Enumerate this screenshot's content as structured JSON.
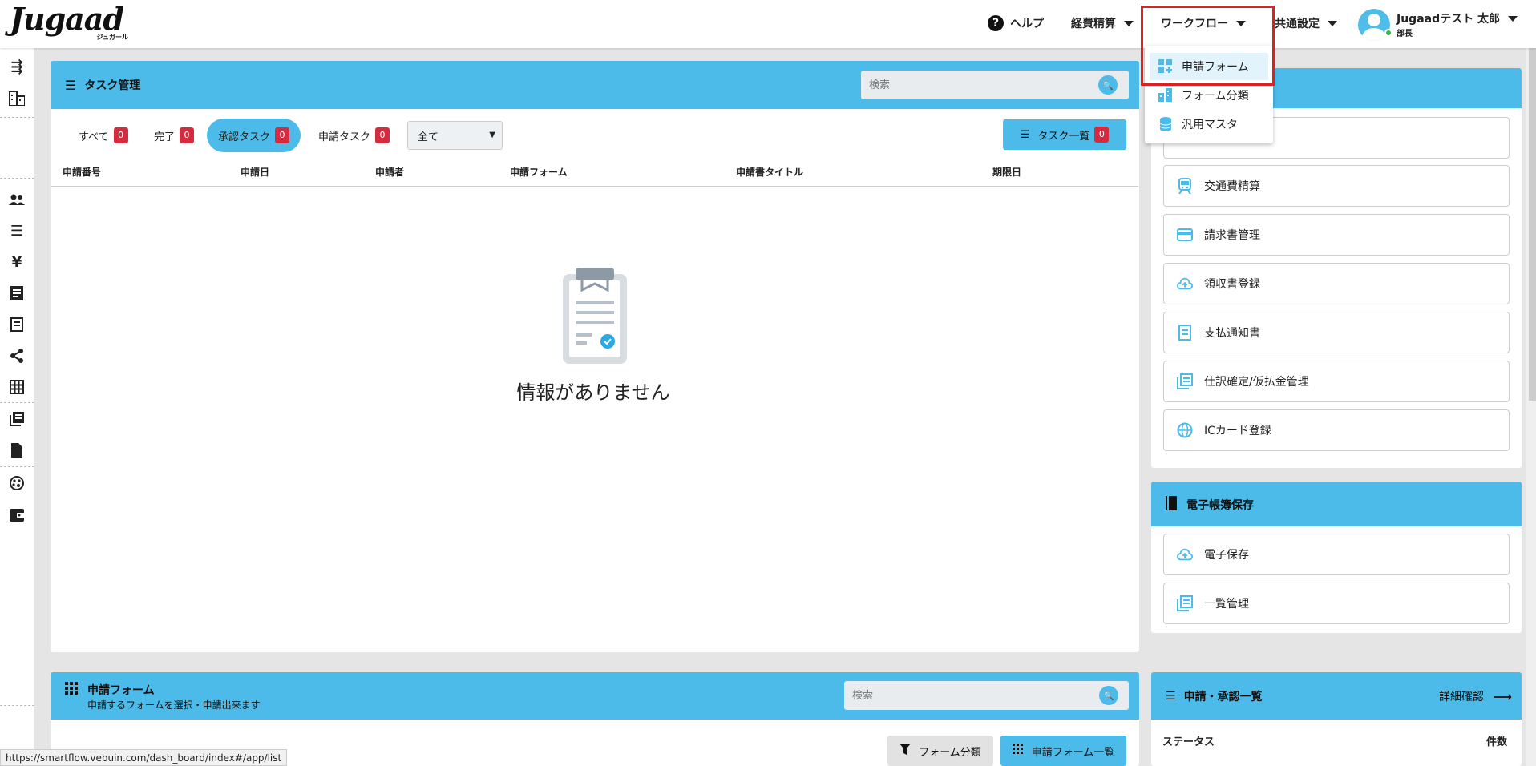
{
  "header": {
    "logo_text": "Jugaad",
    "logo_sub": "ジュガール",
    "nav": {
      "help": "ヘルプ",
      "expense": "経費精算",
      "workflow": "ワークフロー",
      "common": "共通設定"
    },
    "user": {
      "name": "Jugaadテスト 太郎",
      "role": "部長"
    }
  },
  "workflow_menu": {
    "items": [
      {
        "label": "申請フォーム",
        "icon": "form-grid-icon",
        "active": true
      },
      {
        "label": "フォーム分類",
        "icon": "category-icon",
        "active": false
      },
      {
        "label": "汎用マスタ",
        "icon": "database-icon",
        "active": false
      }
    ]
  },
  "task_panel": {
    "title": "タスク管理",
    "search_placeholder": "検索",
    "tabs": [
      {
        "label": "すべて",
        "count": "0"
      },
      {
        "label": "完了",
        "count": "0"
      },
      {
        "label": "承認タスク",
        "count": "0"
      },
      {
        "label": "申請タスク",
        "count": "0"
      }
    ],
    "filter_value": "全て",
    "list_button": "タスク一覧",
    "list_count": "0",
    "columns": [
      "申請番号",
      "申請日",
      "申請者",
      "申請フォーム",
      "申請書タイトル",
      "期限日"
    ],
    "empty_message": "情報がありません"
  },
  "expense_menu": {
    "items": [
      "交通費精算",
      "請求書管理",
      "領収書登録",
      "支払通知書",
      "仕訳確定/仮払金管理",
      "ICカード登録"
    ]
  },
  "ebook_panel": {
    "title": "電子帳簿保存",
    "items": [
      "電子保存",
      "一覧管理"
    ]
  },
  "form_panel": {
    "title": "申請フォーム",
    "subtitle": "申請するフォームを選択・申請出来ます",
    "search_placeholder": "検索",
    "category_button": "フォーム分類",
    "list_button": "申請フォーム一覧"
  },
  "approval_panel": {
    "title": "申請・承認一覧",
    "detail_link": "詳細確認",
    "col_status": "ステータス",
    "col_count": "件数"
  },
  "status_bar": {
    "url": "https://smartflow.vebuin.com/dash_board/index#/app/list"
  },
  "colors": {
    "accent": "#4dbbe9",
    "badge": "#d62b3f",
    "highlight": "#e02020"
  }
}
